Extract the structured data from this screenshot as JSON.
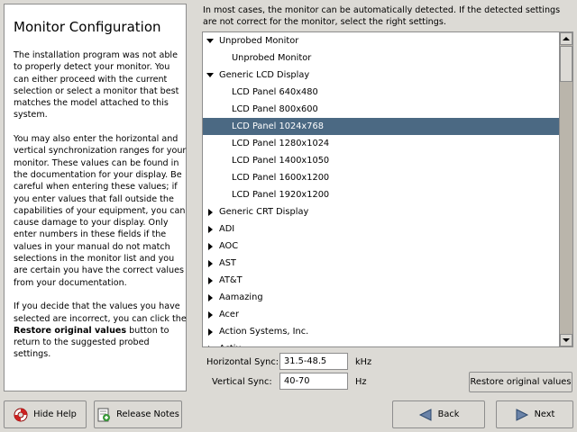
{
  "help": {
    "title": "Monitor Configuration",
    "p1": "The installation program was not able to properly detect your monitor. You can either proceed with the current selection or select a monitor that best matches the model attached to this system.",
    "p2": "You may also enter the horizontal and vertical synchronization ranges for your monitor. These values can be found in the documentation for your display. Be careful when entering these values; if you enter values that fall outside the capabilities of your equipment, you can cause damage to your display. Only enter numbers in these fields if the values in your manual do not match selections in the monitor list and you are certain you have the correct values from your documentation.",
    "p3_before": "If you decide that the values you have selected are incorrect, you can click the ",
    "p3_bold": "Restore original values",
    "p3_after": " button to return to the suggested probed settings."
  },
  "intro": "In most cases, the monitor can be automatically detected. If the detected settings are not correct for the monitor, select the right settings.",
  "tree": {
    "items": [
      {
        "label": "Unprobed Monitor",
        "level": 0,
        "expanded": true
      },
      {
        "label": "Unprobed Monitor",
        "level": 1
      },
      {
        "label": "Generic LCD Display",
        "level": 0,
        "expanded": true
      },
      {
        "label": "LCD Panel 640x480",
        "level": 1
      },
      {
        "label": "LCD Panel 800x600",
        "level": 1
      },
      {
        "label": "LCD Panel 1024x768",
        "level": 1,
        "selected": true
      },
      {
        "label": "LCD Panel 1280x1024",
        "level": 1
      },
      {
        "label": "LCD Panel 1400x1050",
        "level": 1
      },
      {
        "label": "LCD Panel 1600x1200",
        "level": 1
      },
      {
        "label": "LCD Panel 1920x1200",
        "level": 1
      },
      {
        "label": "Generic CRT Display",
        "level": 0,
        "expanded": false
      },
      {
        "label": "ADI",
        "level": 0,
        "expanded": false
      },
      {
        "label": "AOC",
        "level": 0,
        "expanded": false
      },
      {
        "label": "AST",
        "level": 0,
        "expanded": false
      },
      {
        "label": "AT&T",
        "level": 0,
        "expanded": false
      },
      {
        "label": "Aamazing",
        "level": 0,
        "expanded": false
      },
      {
        "label": "Acer",
        "level": 0,
        "expanded": false
      },
      {
        "label": "Action Systems, Inc.",
        "level": 0,
        "expanded": false
      },
      {
        "label": "Actix",
        "level": 0,
        "expanded": false
      }
    ]
  },
  "sync": {
    "horizontal_label": "Horizontal Sync:",
    "horizontal_value": "31.5-48.5",
    "horizontal_unit": "kHz",
    "vertical_label": "Vertical Sync:",
    "vertical_value": "40-70",
    "vertical_unit": "Hz"
  },
  "buttons": {
    "restore": "Restore original values",
    "hide_help": "Hide Help",
    "release_notes": "Release Notes",
    "back": "Back",
    "next": "Next"
  },
  "colors": {
    "selection": "#4b6983",
    "background": "#dcdad5"
  }
}
